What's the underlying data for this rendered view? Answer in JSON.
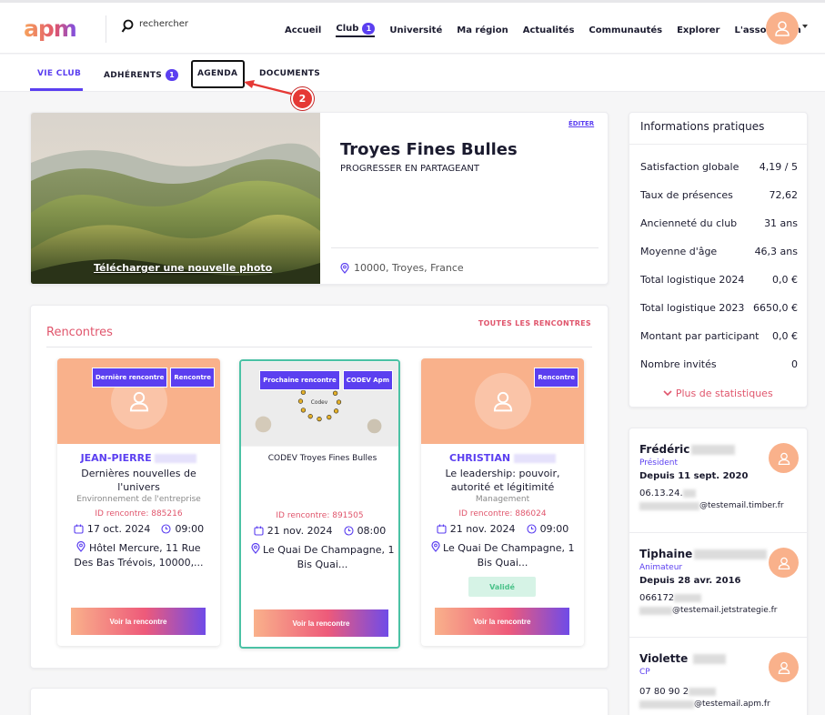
{
  "header": {
    "logo": "apm",
    "search_placeholder": "rechercher",
    "nav": [
      {
        "label": "Accueil"
      },
      {
        "label": "Club",
        "badge": "1"
      },
      {
        "label": "Université"
      },
      {
        "label": "Ma région"
      },
      {
        "label": "Actualités"
      },
      {
        "label": "Communautés"
      },
      {
        "label": "Explorer"
      },
      {
        "label": "L'association"
      }
    ]
  },
  "subtabs": [
    {
      "label": "VIE CLUB"
    },
    {
      "label": "ADHÉRENTS",
      "badge": "1"
    },
    {
      "label": "AGENDA"
    },
    {
      "label": "DOCUMENTS"
    }
  ],
  "annotation": {
    "step": "2"
  },
  "club": {
    "photo_link": "Télécharger une nouvelle photo",
    "edit": "ÉDITER",
    "name": "Troyes Fines Bulles",
    "tagline": "PROGRESSER EN PARTAGEANT",
    "location": "10000, Troyes, France"
  },
  "meetings": {
    "title": "Rencontres",
    "all_link": "TOUTES LES RENCONTRES",
    "cards": [
      {
        "tags": [
          "Dernière rencontre",
          "Rencontre"
        ],
        "name": "JEAN-PIERRE",
        "title": "Dernières nouvelles de l'univers",
        "theme": "Environnement de l'entreprise",
        "id_text": "ID rencontre: 885216",
        "date": "17 oct. 2024",
        "time": "09:00",
        "location": "Hôtel Mercure, 11 Rue Des Bas Trévois, 10000,...",
        "button": "Voir la rencontre"
      },
      {
        "tags": [
          "Prochaine rencontre",
          "CODEV Apm"
        ],
        "title": "CODEV Troyes Fines Bulles",
        "id_text": "ID rencontre: 891505",
        "date": "21 nov. 2024",
        "time": "08:00",
        "location": "Le Quai De Champagne, 1 Bis Quai...",
        "button": "Voir la rencontre"
      },
      {
        "tags": [
          "Rencontre"
        ],
        "name": "CHRISTIAN",
        "title": "Le leadership: pouvoir, autorité et légitimité",
        "theme": "Management",
        "id_text": "ID rencontre: 886024",
        "date": "21 nov. 2024",
        "time": "09:00",
        "location": "Le Quai De Champagne, 1 Bis Quai...",
        "status": "Validé",
        "button": "Voir la rencontre"
      }
    ]
  },
  "info": {
    "title": "Informations pratiques",
    "rows": [
      {
        "label": "Satisfaction globale",
        "value": "4,19 / 5"
      },
      {
        "label": "Taux de présences",
        "value": "72,62"
      },
      {
        "label": "Ancienneté du club",
        "value": "31 ans"
      },
      {
        "label": "Moyenne d'âge",
        "value": "46,3 ans"
      },
      {
        "label": "Total logistique 2024",
        "value": "0,0 €"
      },
      {
        "label": "Total logistique 2023",
        "value": "6650,0 €"
      },
      {
        "label": "Montant par participant",
        "value": "0,0 €"
      },
      {
        "label": "Nombre invités",
        "value": "0"
      }
    ],
    "more": "Plus de statistiques"
  },
  "people": [
    {
      "name": "Frédéric",
      "role": "Président",
      "since": "Depuis 11 sept. 2020",
      "phone": "06.13.24.",
      "email": "@testemail.timber.fr"
    },
    {
      "name": "Tiphaine",
      "role": "Animateur",
      "since": "Depuis 28 avr. 2016",
      "phone": "066172",
      "email": "@testemail.jetstrategie.fr"
    },
    {
      "name": "Violette",
      "role": "CP",
      "phone": "07 80 90 2",
      "email": "@testemail.apm.fr"
    }
  ],
  "colors": {
    "accent": "#5b3ff0",
    "coral": "#e0556c",
    "peach": "#f9b18b",
    "green": "#4bc2a5"
  }
}
